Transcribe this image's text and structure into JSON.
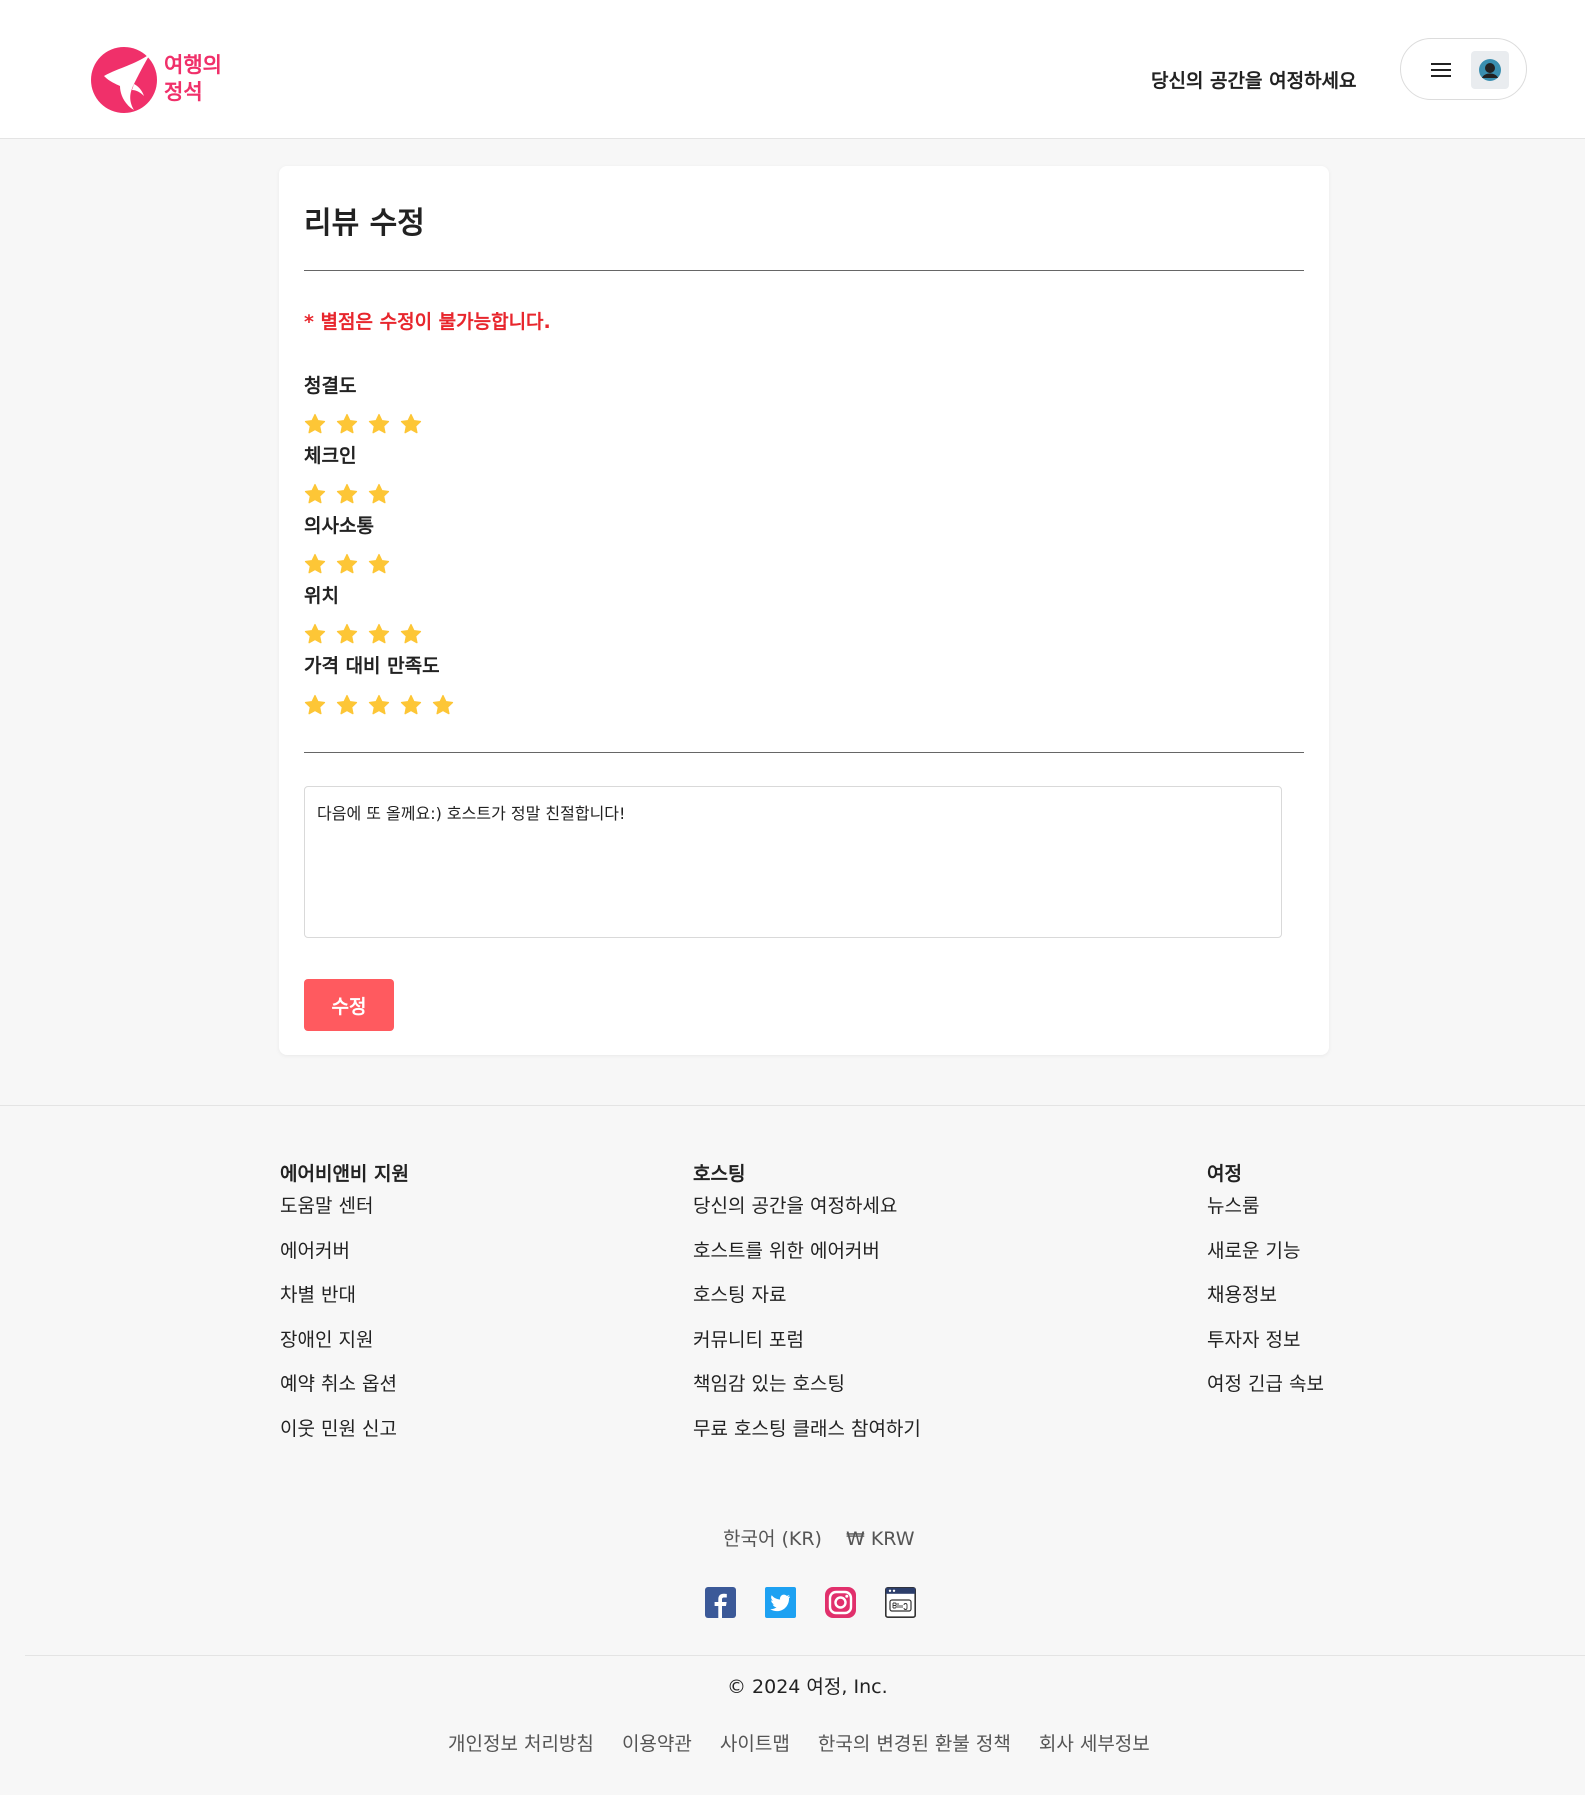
{
  "header": {
    "logo_text_line1": "여행의",
    "logo_text_line2": "정석",
    "host_link": "당신의 공간을 여정하세요",
    "brand_color": "#f0306a"
  },
  "review_edit": {
    "title": "리뷰 수정",
    "notice": "* 별점은 수정이 불가능합니다.",
    "ratings": [
      {
        "label": "청결도",
        "stars": 4
      },
      {
        "label": "체크인",
        "stars": 3
      },
      {
        "label": "의사소통",
        "stars": 3
      },
      {
        "label": "위치",
        "stars": 4
      },
      {
        "label": "가격 대비 만족도",
        "stars": 5
      }
    ],
    "review_text": "다음에 또 올께요:) 호스트가 정말 친절합니다!",
    "submit_label": "수정",
    "star_color": "#fdc636",
    "button_color": "#ff5a5f",
    "notice_color": "#e8262d"
  },
  "footer": {
    "columns": [
      {
        "heading": "에어비앤비 지원",
        "links": [
          "도움말 센터",
          "에어커버",
          "차별 반대",
          "장애인 지원",
          "예약 취소 옵션",
          "이웃 민원 신고"
        ]
      },
      {
        "heading": "호스팅",
        "links": [
          "당신의 공간을 여정하세요",
          "호스트를 위한 에어커버",
          "호스팅 자료",
          "커뮤니티 포럼",
          "책임감 있는 호스팅",
          "무료 호스팅 클래스 참여하기"
        ]
      },
      {
        "heading": "여정",
        "links": [
          "뉴스룸",
          "새로운 기능",
          "채용정보",
          "투자자 정보",
          "여정 긴급 속보"
        ]
      }
    ],
    "language": "한국어 (KR)",
    "currency": "₩ KRW",
    "socials": [
      "facebook-icon",
      "twitter-icon",
      "instagram-icon",
      "blog-icon"
    ],
    "copyright": "© 2024 여정, Inc.",
    "bottom_links": [
      "개인정보 처리방침",
      "이용약관",
      "사이트맵",
      "한국의 변경된 환불 정책",
      "회사 세부정보"
    ]
  }
}
